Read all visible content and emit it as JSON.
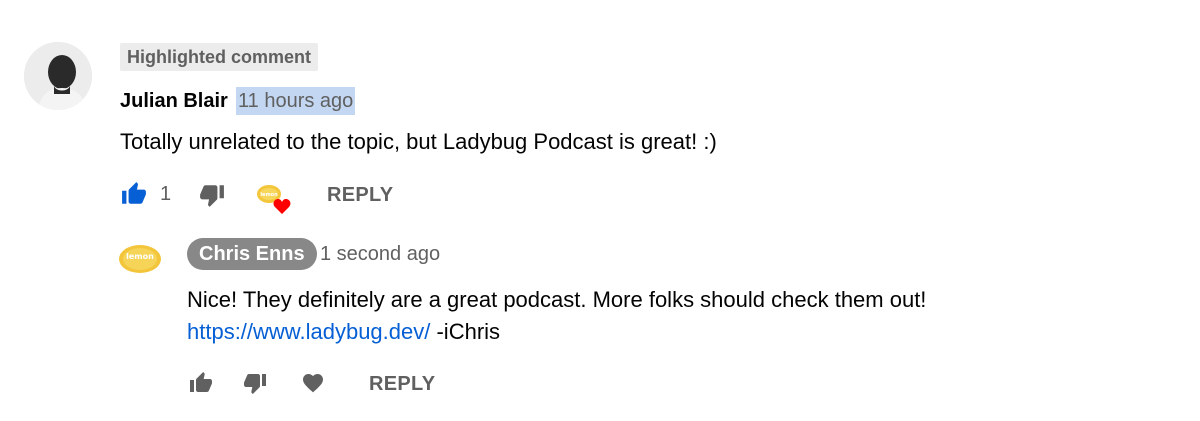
{
  "comment": {
    "badge": "Highlighted comment",
    "author": "Julian Blair",
    "time": "11 hours ago",
    "text": "Totally unrelated to the topic, but Ladybug Podcast is great! :)",
    "like_count": "1",
    "reply_label": "REPLY",
    "creator_heart_avatar_text": "lemon"
  },
  "reply": {
    "author": "Chris Enns",
    "time": "1 second ago",
    "text_line1": "Nice! They definitely are a great podcast. More folks should check them out!",
    "link": "https://www.ladybug.dev/",
    "signature": "-iChris",
    "reply_label": "REPLY",
    "avatar_text": "lemon"
  },
  "colors": {
    "liked_blue": "#065fd4",
    "icon_grey": "#606060",
    "heart_red": "#ff0000",
    "highlight_bg": "#c3d7f3",
    "chip_bg": "#888888"
  }
}
